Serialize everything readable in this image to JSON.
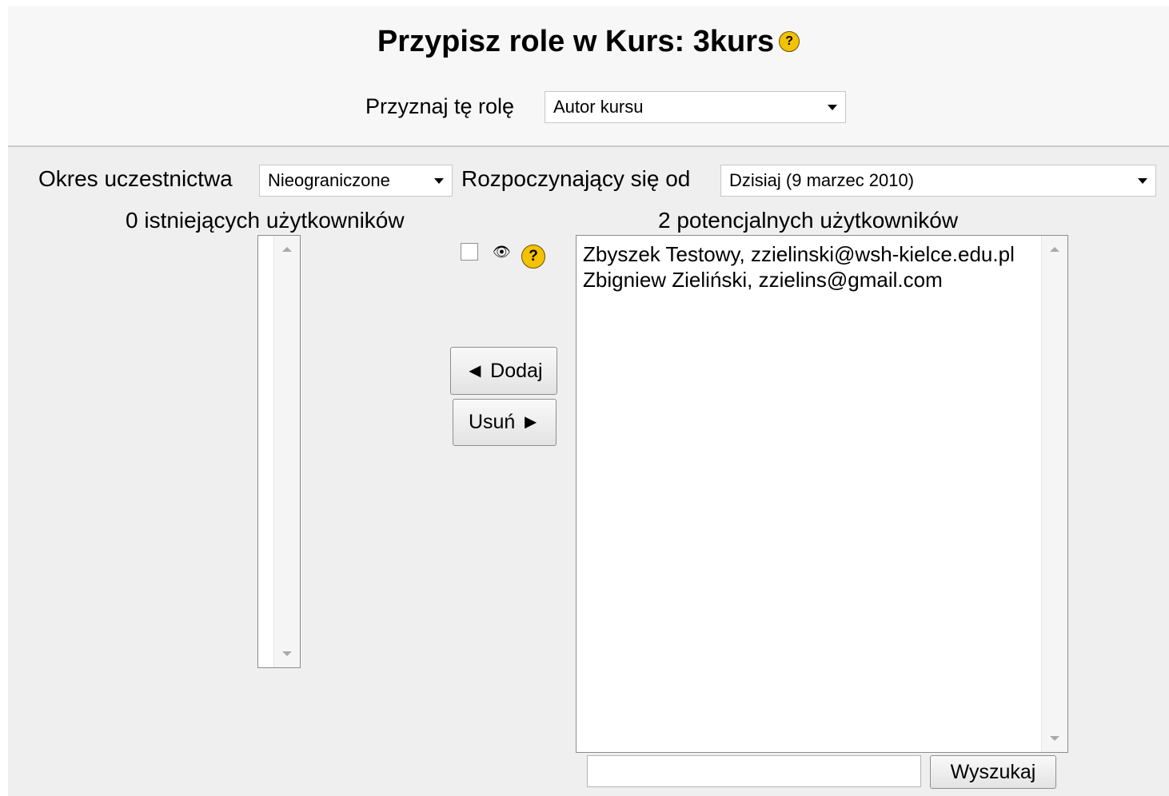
{
  "header": {
    "title": "Przypisz role w Kurs: 3kurs",
    "role_label": "Przyznaj tę rolę",
    "role_value": "Autor kursu"
  },
  "enrol": {
    "period_label": "Okres uczestnictwa",
    "period_value": "Nieograniczone",
    "start_label": "Rozpoczynający się od",
    "start_value": "Dzisiaj (9 marzec 2010)"
  },
  "existing": {
    "label": "0 istniejących użytkowników",
    "items": []
  },
  "potential": {
    "label": "2 potencjalnych użytkowników",
    "items": [
      "Zbyszek Testowy, zzielinski@wsh-kielce.edu.pl",
      "Zbigniew Zieliński, zzielins@gmail.com"
    ]
  },
  "actions": {
    "add_label": "◄ Dodaj",
    "remove_label": "Usuń ►"
  },
  "search": {
    "value": "",
    "button_label": "Wyszukaj"
  },
  "icons": {
    "help": "help-icon",
    "eye": "eye-icon"
  },
  "colors": {
    "help_icon": "#f3c200",
    "panel_bg": "#efefef"
  }
}
